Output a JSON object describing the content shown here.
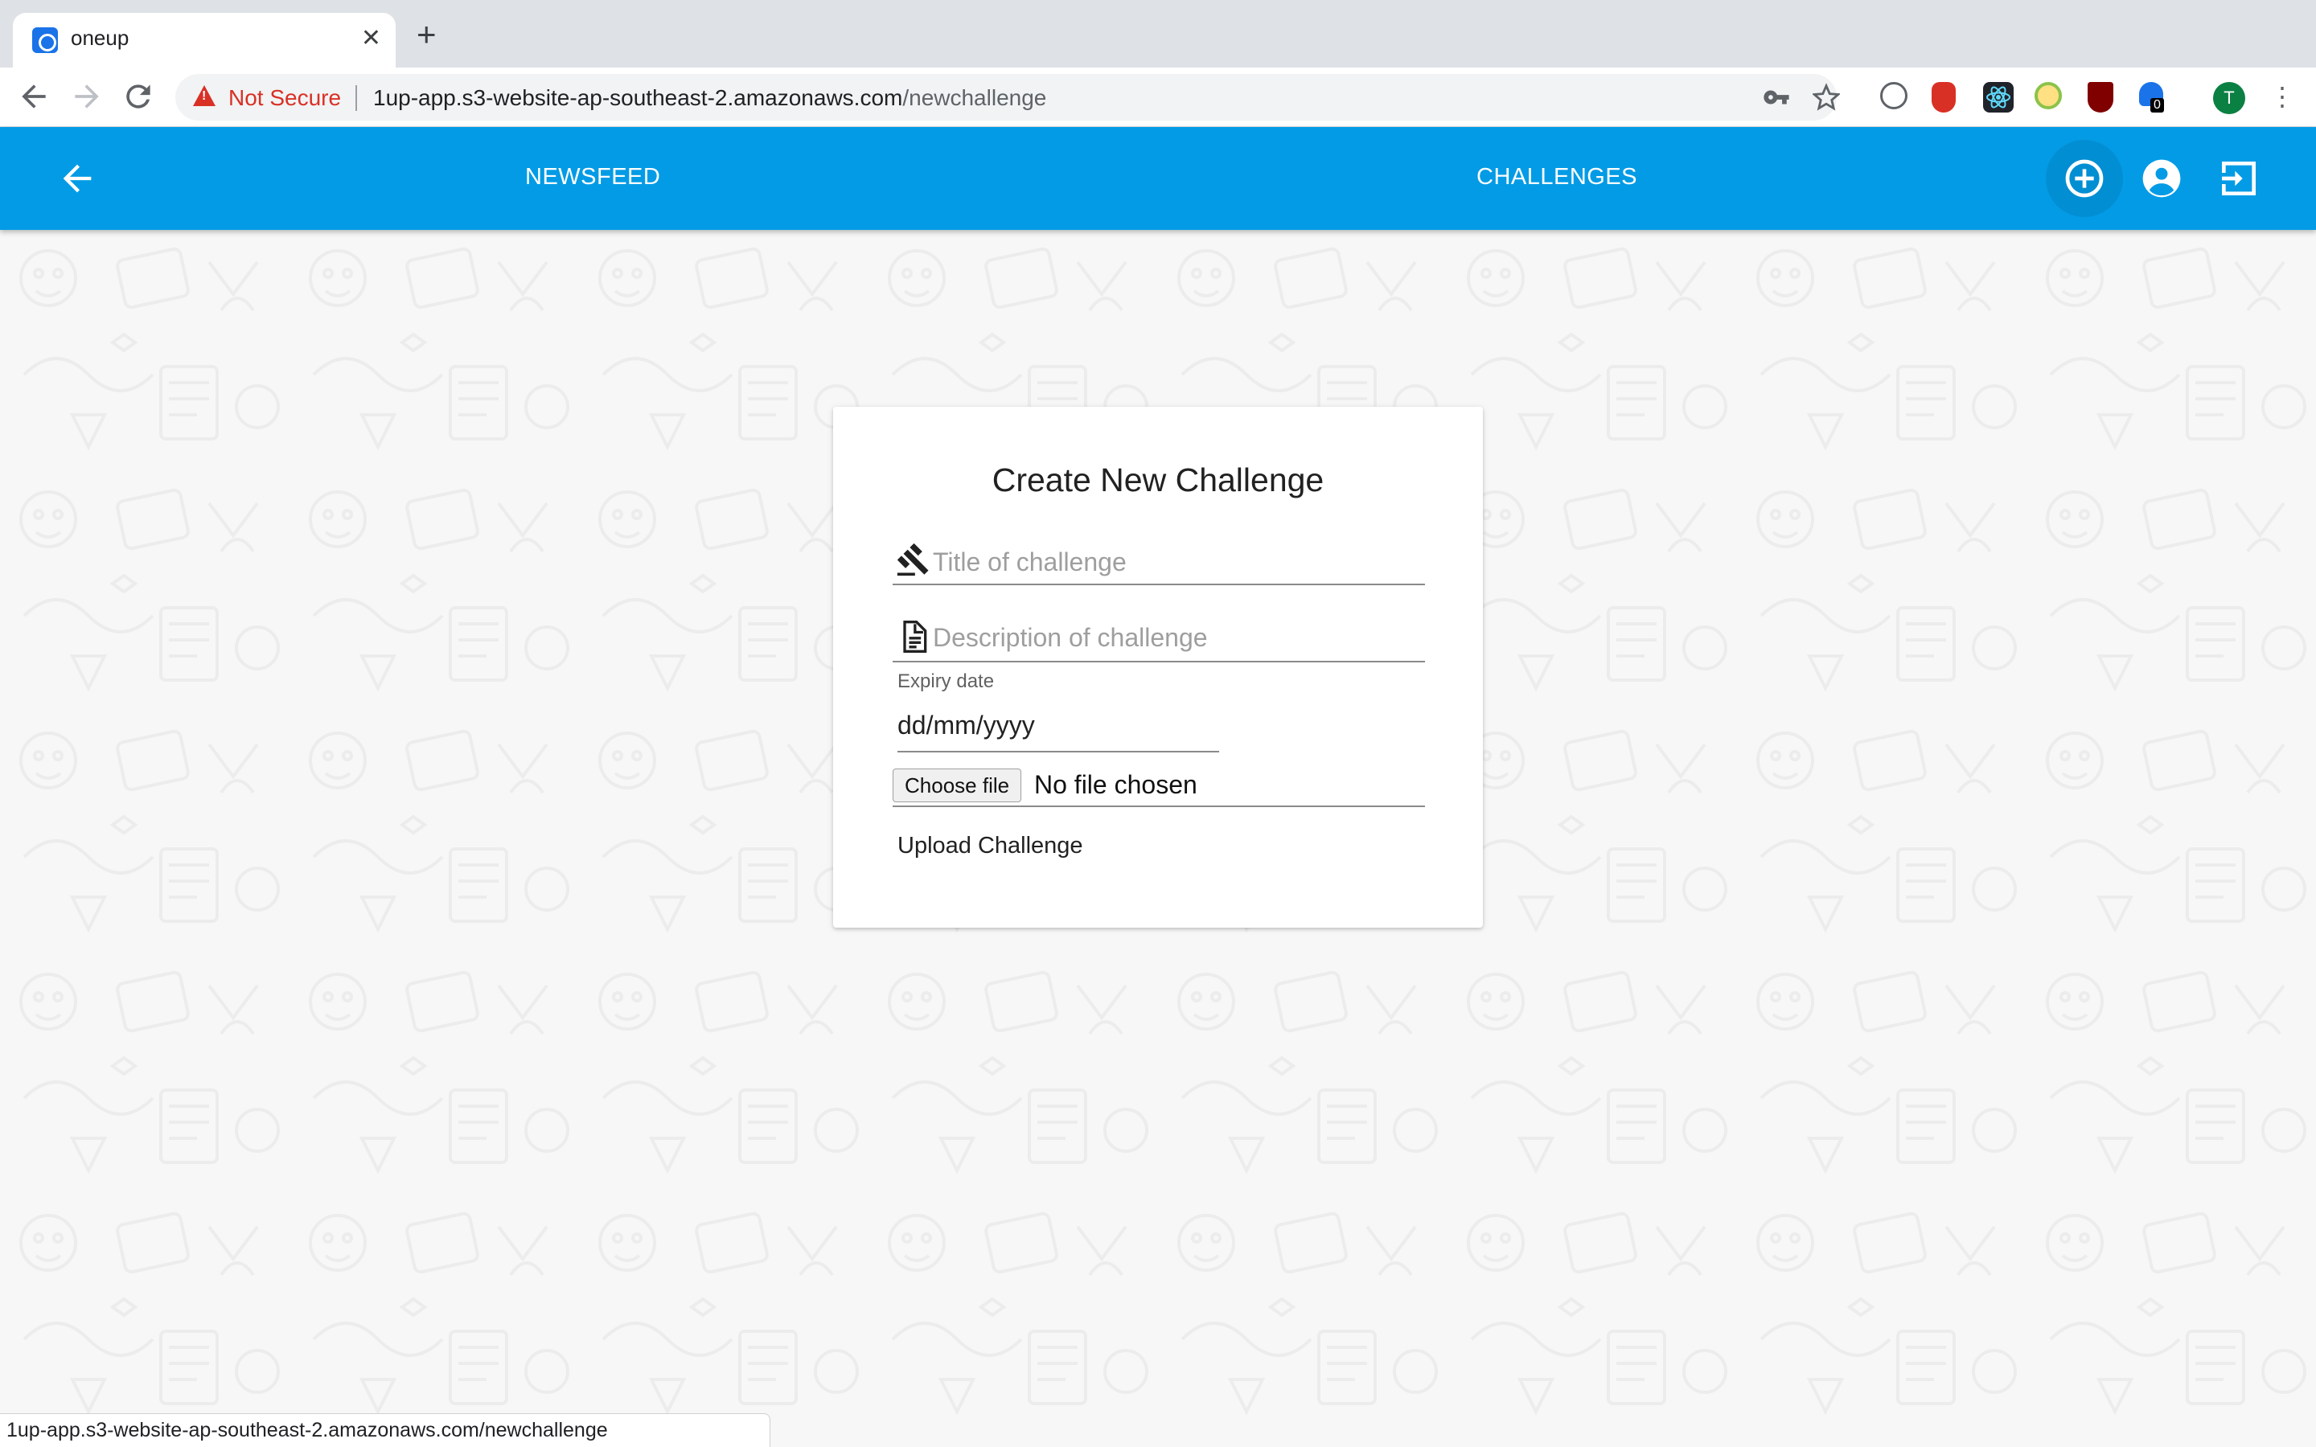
{
  "browser": {
    "tab_title": "oneup",
    "tab_close": "✕",
    "new_tab": "+",
    "security_label": "Not Secure",
    "url_host": "1up-app.s3-website-ap-southeast-2.amazonaws.com",
    "url_path": "/newchallenge",
    "profile_initial": "T",
    "extension_badge": "0",
    "status_url": "1up-app.s3-website-ap-southeast-2.amazonaws.com/newchallenge"
  },
  "appbar": {
    "newsfeed_label": "NEWSFEED",
    "challenges_label": "CHALLENGES",
    "color": "#039be5"
  },
  "form": {
    "title": "Create New Challenge",
    "title_placeholder": "Title of challenge",
    "description_placeholder": "Description of challenge",
    "expiry_label": "Expiry date",
    "expiry_value": "dd/mm/yyyy",
    "choose_file_label": "Choose file",
    "file_status": "No file chosen",
    "upload_label": "Upload Challenge"
  },
  "icons": {
    "back": "arrow-back-icon",
    "add": "add-circle-icon",
    "profile": "account-circle-icon",
    "logout": "exit-icon",
    "title_field": "gavel-icon",
    "description_field": "document-icon"
  }
}
